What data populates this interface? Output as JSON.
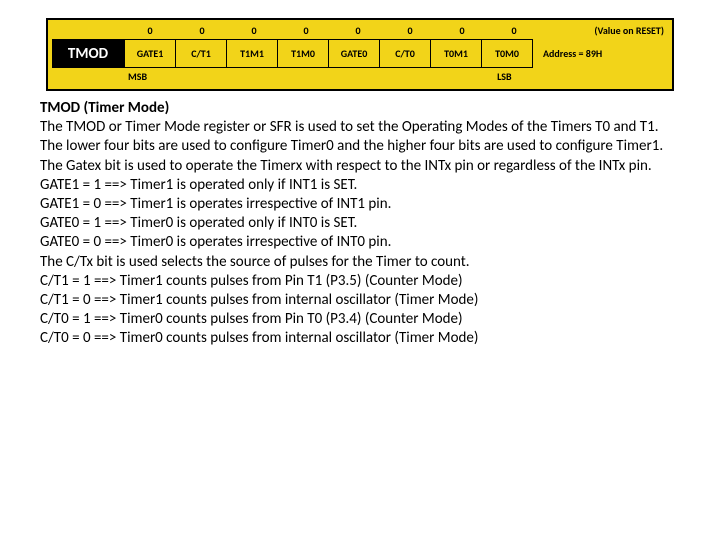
{
  "diagram": {
    "reset_values": [
      "0",
      "0",
      "0",
      "0",
      "0",
      "0",
      "0",
      "0"
    ],
    "reset_caption": "(Value on RESET)",
    "register_name": "TMOD",
    "bits": [
      "GATE1",
      "C/T1",
      "T1M1",
      "T1M0",
      "GATE0",
      "C/T0",
      "T0M1",
      "T0M0"
    ],
    "address_label": "Address = 89H",
    "msb": "MSB",
    "lsb": "LSB"
  },
  "text": {
    "title": "TMOD (Timer Mode)",
    "p1": "The TMOD or Timer Mode register or SFR is used to set the Operating Modes of the Timers T0 and T1. The lower four bits are used to configure Timer0 and the higher four bits are used to configure Timer1.",
    "p2": "The Gatex bit is used to operate the Timerx with respect to the INTx pin or regardless of the INTx pin.",
    "g1a": "GATE1 = 1 ==> Timer1 is operated only if INT1 is SET.",
    "g1b": "GATE1 = 0 ==> Timer1 is operates irrespective of INT1 pin.",
    "g0a": "GATE0 = 1 ==> Timer0 is operated only if INT0 is SET.",
    "g0b": "GATE0 = 0 ==> Timer0 is operates irrespective of INT0 pin.",
    "p3": "The C/Tx bit is used selects the source of pulses for the Timer to count.",
    "c1a": "C/T1 = 1 ==> Timer1 counts pulses from Pin T1 (P3.5) (Counter Mode)",
    "c1b": "C/T1 = 0 ==> Timer1 counts pulses from internal oscillator (Timer Mode)",
    "c0a": "C/T0 = 1 ==> Timer0 counts pulses from Pin T0 (P3.4) (Counter Mode)",
    "c0b": "C/T0 = 0 ==> Timer0 counts pulses from internal oscillator (Timer Mode)"
  }
}
